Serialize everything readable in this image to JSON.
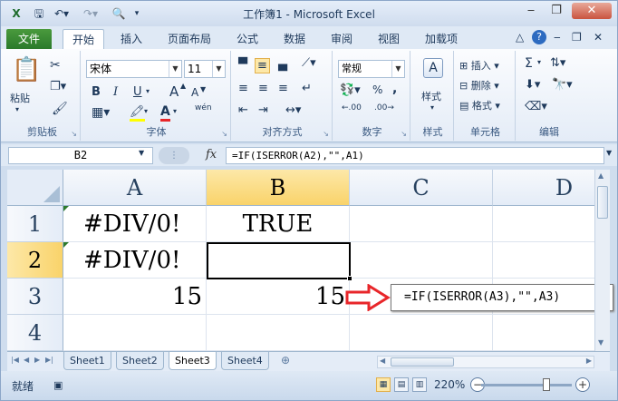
{
  "window": {
    "title": "工作簿1 - Microsoft Excel"
  },
  "tabs": {
    "file": "文件",
    "items": [
      "开始",
      "插入",
      "页面布局",
      "公式",
      "数据",
      "审阅",
      "视图",
      "加载项"
    ],
    "active": "开始"
  },
  "ribbon": {
    "clipboard": {
      "label": "剪贴板",
      "paste": "粘贴"
    },
    "font": {
      "label": "字体",
      "name": "宋体",
      "size": "11",
      "bold": "B",
      "italic": "I",
      "underline": "U",
      "grow": "A",
      "shrink": "A",
      "fontcolor": "A",
      "phonetic": "wén"
    },
    "alignment": {
      "label": "对齐方式"
    },
    "number": {
      "label": "数字",
      "format": "常规",
      "percent": "%",
      "comma": ",",
      "inc_dec": ".00",
      "dec_dec": ".00"
    },
    "styles": {
      "label": "样式",
      "button": "样式"
    },
    "cells": {
      "label": "单元格",
      "insert": "插入",
      "delete": "删除",
      "format": "格式"
    },
    "editing": {
      "label": "编辑",
      "sum": "Σ"
    }
  },
  "formula_bar": {
    "name_box": "B2",
    "fx": "fx",
    "formula": "=IF(ISERROR(A2),\"\",A1)"
  },
  "grid": {
    "columns": [
      "A",
      "B",
      "C",
      "D"
    ],
    "selected_column": "B",
    "rows": [
      {
        "num": "1",
        "cells": [
          "#DIV/0!",
          "TRUE",
          "",
          ""
        ]
      },
      {
        "num": "2",
        "cells": [
          "#DIV/0!",
          "",
          "",
          ""
        ]
      },
      {
        "num": "3",
        "cells": [
          "15",
          "15",
          "",
          ""
        ]
      },
      {
        "num": "4",
        "cells": [
          "",
          "",
          "",
          ""
        ]
      }
    ],
    "selected_row": "2",
    "selected_cell": "B2"
  },
  "annotation": {
    "text": "=IF(ISERROR(A3),\"\",A3)",
    "arrow_color": "#e8262a"
  },
  "sheets": {
    "tabs": [
      "Sheet1",
      "Sheet2",
      "Sheet3",
      "Sheet4"
    ],
    "active": "Sheet3"
  },
  "status": {
    "ready": "就绪",
    "zoom": "220%"
  },
  "colors": {
    "file_tab": "#2b7a2b",
    "header_selected": "#f9d36a",
    "error_triangle": "#2d7a2d"
  }
}
